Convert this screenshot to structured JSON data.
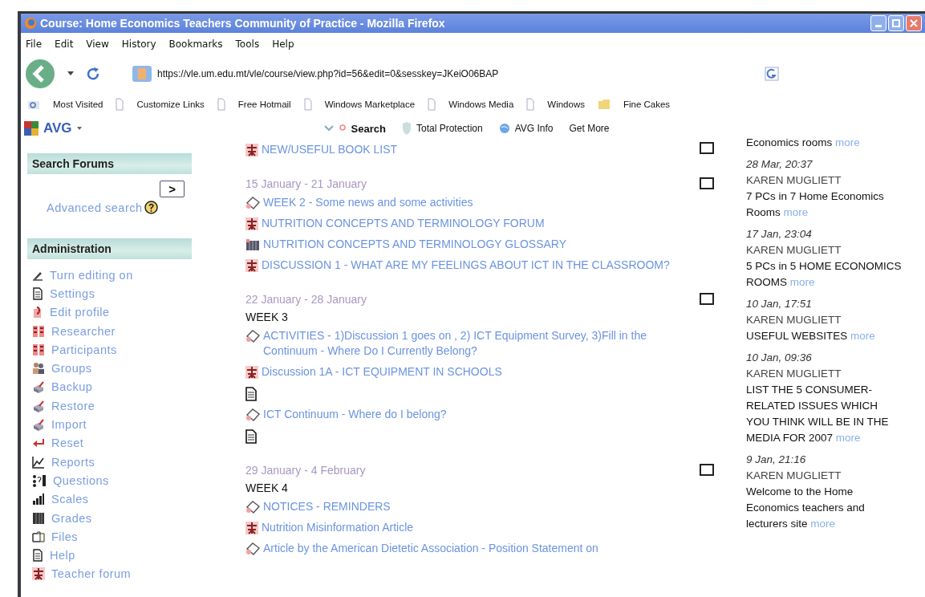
{
  "window": {
    "title": "Course: Home Economics Teachers Community of Practice - Mozilla Firefox"
  },
  "menu": [
    "File",
    "Edit",
    "View",
    "History",
    "Bookmarks",
    "Tools",
    "Help"
  ],
  "address": {
    "url": "https://vle.um.edu.mt/vle/course/view.php?id=56&edit=0&sesskey=JKeiO06BAP"
  },
  "bookmarks": [
    {
      "label": "Most Visited",
      "kind": "smart"
    },
    {
      "label": "Customize Links",
      "kind": "page"
    },
    {
      "label": "Free Hotmail",
      "kind": "page"
    },
    {
      "label": "Windows Marketplace",
      "kind": "page"
    },
    {
      "label": "Windows Media",
      "kind": "page"
    },
    {
      "label": "Windows",
      "kind": "page"
    },
    {
      "label": "Fine Cakes",
      "kind": "folder"
    }
  ],
  "avg_toolbar": {
    "brand": "AVG",
    "items": [
      {
        "label": "Search",
        "kind": "search"
      },
      {
        "label": "Total Protection",
        "kind": "shield"
      },
      {
        "label": "AVG Info",
        "kind": "info"
      },
      {
        "label": "Get More",
        "kind": "plain"
      }
    ]
  },
  "sidebar": {
    "search_block": {
      "title": "Search Forums",
      "button": ">",
      "link": "Advanced search"
    },
    "admin_block": {
      "title": "Administration",
      "items": [
        {
          "label": "Turn editing on",
          "kind": "edit"
        },
        {
          "label": "Settings",
          "kind": "doc"
        },
        {
          "label": "Edit profile",
          "kind": "profile"
        },
        {
          "label": "Researcher",
          "kind": "users"
        },
        {
          "label": "Participants",
          "kind": "users"
        },
        {
          "label": "Groups",
          "kind": "groups"
        },
        {
          "label": "Backup",
          "kind": "box"
        },
        {
          "label": "Restore",
          "kind": "box"
        },
        {
          "label": "Import",
          "kind": "box"
        },
        {
          "label": "Reset",
          "kind": "reset"
        },
        {
          "label": "Reports",
          "kind": "reports"
        },
        {
          "label": "Questions",
          "kind": "questions"
        },
        {
          "label": "Scales",
          "kind": "scales"
        },
        {
          "label": "Grades",
          "kind": "grades"
        },
        {
          "label": "Files",
          "kind": "files"
        },
        {
          "label": "Help",
          "kind": "doc"
        },
        {
          "label": "Teacher forum",
          "kind": "forum"
        }
      ]
    }
  },
  "course": {
    "sections": [
      {
        "checked": false,
        "items": [
          {
            "kind": "forum",
            "title": "NEW/USEFUL BOOK LIST"
          }
        ]
      },
      {
        "date": "15 January - 21 January",
        "checked": false,
        "items": [
          {
            "kind": "assignment",
            "title": "WEEK 2 - Some news and some activities"
          },
          {
            "kind": "forum",
            "title": "NUTRITION CONCEPTS AND TERMINOLOGY FORUM"
          },
          {
            "kind": "glossary",
            "title": "NUTRITION CONCEPTS AND TERMINOLOGY GLOSSARY"
          },
          {
            "kind": "forum",
            "title": "DISCUSSION 1 - WHAT ARE MY FEELINGS ABOUT ICT IN THE CLASSROOM?"
          }
        ]
      },
      {
        "date": "22 January - 28 January",
        "title": "WEEK 3",
        "checked": false,
        "items": [
          {
            "kind": "assignment",
            "title": "ACTIVITIES - 1)Discussion 1 goes on , 2) ICT Equipment Survey, 3)Fill in the Continuum - Where Do I Currently Belong?"
          },
          {
            "kind": "forum",
            "title": "Discussion 1A - ICT EQUIPMENT IN SCHOOLS"
          },
          {
            "kind": "resource"
          },
          {
            "kind": "assignment",
            "title": "ICT Continuum - Where do I belong?"
          },
          {
            "kind": "resource"
          }
        ]
      },
      {
        "date": "29 January - 4 February",
        "title": "WEEK 4",
        "checked": false,
        "items": [
          {
            "kind": "assignment",
            "title": "NOTICES - REMINDERS"
          },
          {
            "kind": "forum",
            "title": "Nutrition Misinformation Article"
          },
          {
            "kind": "assignment",
            "title": "Article by the American Dietetic Association - Position Statement on"
          }
        ]
      }
    ]
  },
  "news": {
    "items": [
      {
        "subject": "Economics rooms",
        "more": "more"
      },
      {
        "date": "28 Mar, 20:37",
        "author": "KAREN MUGLIETT",
        "subject": "7 PCs in 7 Home Economics Rooms",
        "more": "more"
      },
      {
        "date": "17 Jan, 23:04",
        "author": "KAREN MUGLIETT",
        "subject": "5 PCs in 5 HOME ECONOMICS ROOMS",
        "more": "more"
      },
      {
        "date": "10 Jan, 17:51",
        "author": "KAREN MUGLIETT",
        "subject": "USEFUL WEBSITES",
        "more": "more"
      },
      {
        "date": "10 Jan, 09:36",
        "author": "KAREN MUGLIETT",
        "subject": "LIST THE 5 CONSUMER-RELATED ISSUES WHICH YOU THINK WILL BE IN THE MEDIA FOR 2007",
        "more": "more"
      },
      {
        "date": "9 Jan, 21:16",
        "author": "KAREN MUGLIETT",
        "subject": "Welcome to the Home Economics teachers and lecturers site",
        "more": "more"
      }
    ]
  }
}
